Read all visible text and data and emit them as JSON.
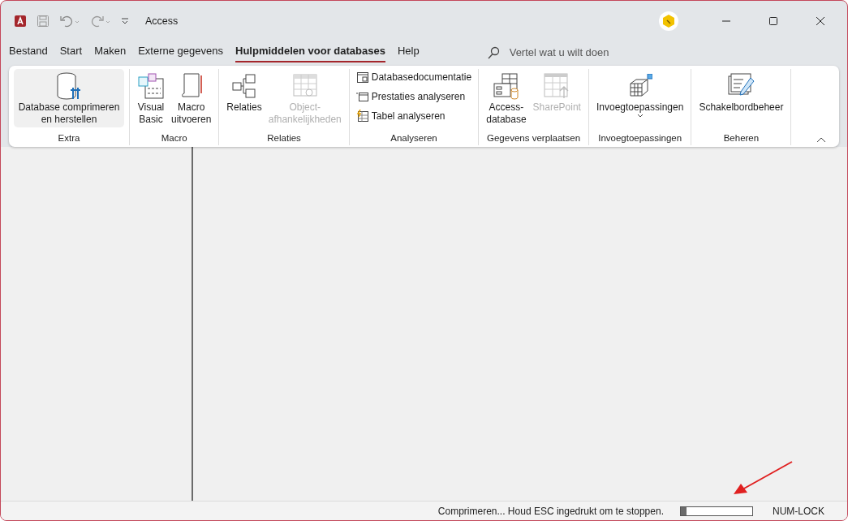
{
  "window": {
    "title": "Access"
  },
  "tabs": [
    {
      "label": "Bestand",
      "selected": false
    },
    {
      "label": "Start",
      "selected": false
    },
    {
      "label": "Maken",
      "selected": false
    },
    {
      "label": "Externe gegevens",
      "selected": false
    },
    {
      "label": "Hulpmiddelen voor databases",
      "selected": true
    },
    {
      "label": "Help",
      "selected": false
    }
  ],
  "search": {
    "placeholder": "Vertel wat u wilt doen"
  },
  "ribbon": {
    "groups": [
      {
        "label": "Extra",
        "buttons": [
          {
            "kind": "large",
            "label": "Database comprimeren en herstellen",
            "highlighted": true,
            "disabled": false
          }
        ]
      },
      {
        "label": "Macro",
        "buttons": [
          {
            "kind": "large",
            "label": "Visual Basic",
            "highlighted": false,
            "disabled": false
          },
          {
            "kind": "large",
            "label": "Macro uitvoeren",
            "highlighted": false,
            "disabled": false
          }
        ]
      },
      {
        "label": "Relaties",
        "buttons": [
          {
            "kind": "large",
            "label": "Relaties",
            "highlighted": false,
            "disabled": false
          },
          {
            "kind": "large",
            "label": "Object-afhankelijkheden",
            "highlighted": false,
            "disabled": true
          }
        ]
      },
      {
        "label": "Analyseren",
        "buttons": [
          {
            "kind": "small",
            "label": "Databasedocumentatie",
            "highlighted": false,
            "disabled": false
          },
          {
            "kind": "small",
            "label": "Prestaties analyseren",
            "highlighted": false,
            "disabled": false
          },
          {
            "kind": "small",
            "label": "Tabel analyseren",
            "highlighted": false,
            "disabled": false
          }
        ]
      },
      {
        "label": "Gegevens verplaatsen",
        "buttons": [
          {
            "kind": "large",
            "label": "Access-database",
            "highlighted": false,
            "disabled": false
          },
          {
            "kind": "large",
            "label": "SharePoint",
            "highlighted": false,
            "disabled": true
          }
        ]
      },
      {
        "label": "Invoegtoepassingen",
        "buttons": [
          {
            "kind": "dropdown",
            "label": "Invoegtoepassingen",
            "highlighted": false,
            "disabled": false
          }
        ]
      },
      {
        "label": "Beheren",
        "buttons": [
          {
            "kind": "large",
            "label": "Schakelbordbeheer",
            "highlighted": false,
            "disabled": false
          }
        ]
      }
    ]
  },
  "status_bar": {
    "message": "Comprimeren... Houd ESC ingedrukt om te stoppen.",
    "progress": {
      "level": 0.08
    },
    "indicator": "NUM-LOCK"
  }
}
